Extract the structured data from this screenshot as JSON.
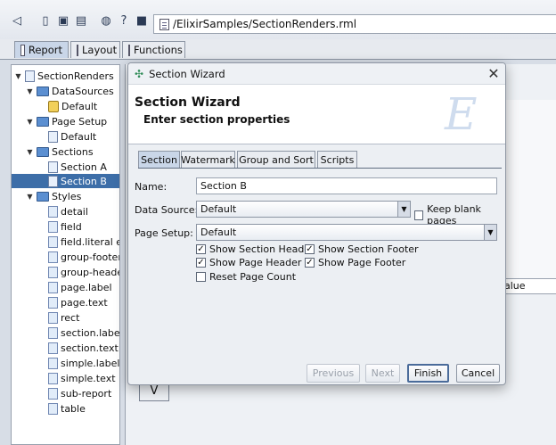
{
  "toolbar": {
    "path": "/ElixirSamples/SectionRenders.rml"
  },
  "main_tabs": [
    {
      "label": "Report",
      "active": true
    },
    {
      "label": "Layout",
      "active": false
    },
    {
      "label": "Functions",
      "active": false
    }
  ],
  "tree": {
    "root": "SectionRenders",
    "datasources": "DataSources",
    "datasources_default": "Default",
    "page_setup": "Page Setup",
    "page_setup_default": "Default",
    "sections": "Sections",
    "section_a": "Section A",
    "section_b": "Section B",
    "styles": "Styles",
    "style_items": [
      "detail",
      "field",
      "field.literal exte",
      "group-footer",
      "group-header",
      "page.label",
      "page.text",
      "rect",
      "section.label",
      "section.text",
      "simple.label",
      "simple.text",
      "sub-report",
      "table"
    ]
  },
  "background": {
    "value_label": "alue",
    "v_button": "V"
  },
  "dialog": {
    "window_title": "Section Wizard",
    "title": "Section Wizard",
    "subtitle": "Enter section properties",
    "logo_letter": "E",
    "close_glyph": "✕",
    "tabs": [
      {
        "label": "Section",
        "active": true
      },
      {
        "label": "Watermark",
        "active": false
      },
      {
        "label": "Group and Sort",
        "active": false
      },
      {
        "label": "Scripts",
        "active": false
      }
    ],
    "name_label": "Name:",
    "name_value": "Section B",
    "datasource_label": "Data Source:",
    "datasource_value": "Default",
    "keep_blank_label": "Keep blank pages",
    "keep_blank_checked": false,
    "page_setup_label": "Page Setup:",
    "page_setup_value": "Default",
    "options": {
      "show_section_header": {
        "label": "Show Section Header",
        "checked": true
      },
      "show_section_footer": {
        "label": "Show Section Footer",
        "checked": true
      },
      "show_page_header": {
        "label": "Show Page Header",
        "checked": true
      },
      "show_page_footer": {
        "label": "Show Page Footer",
        "checked": true
      },
      "reset_page_count": {
        "label": "Reset Page Count",
        "checked": false
      }
    },
    "buttons": {
      "previous": "Previous",
      "next": "Next",
      "finish": "Finish",
      "cancel": "Cancel"
    }
  }
}
